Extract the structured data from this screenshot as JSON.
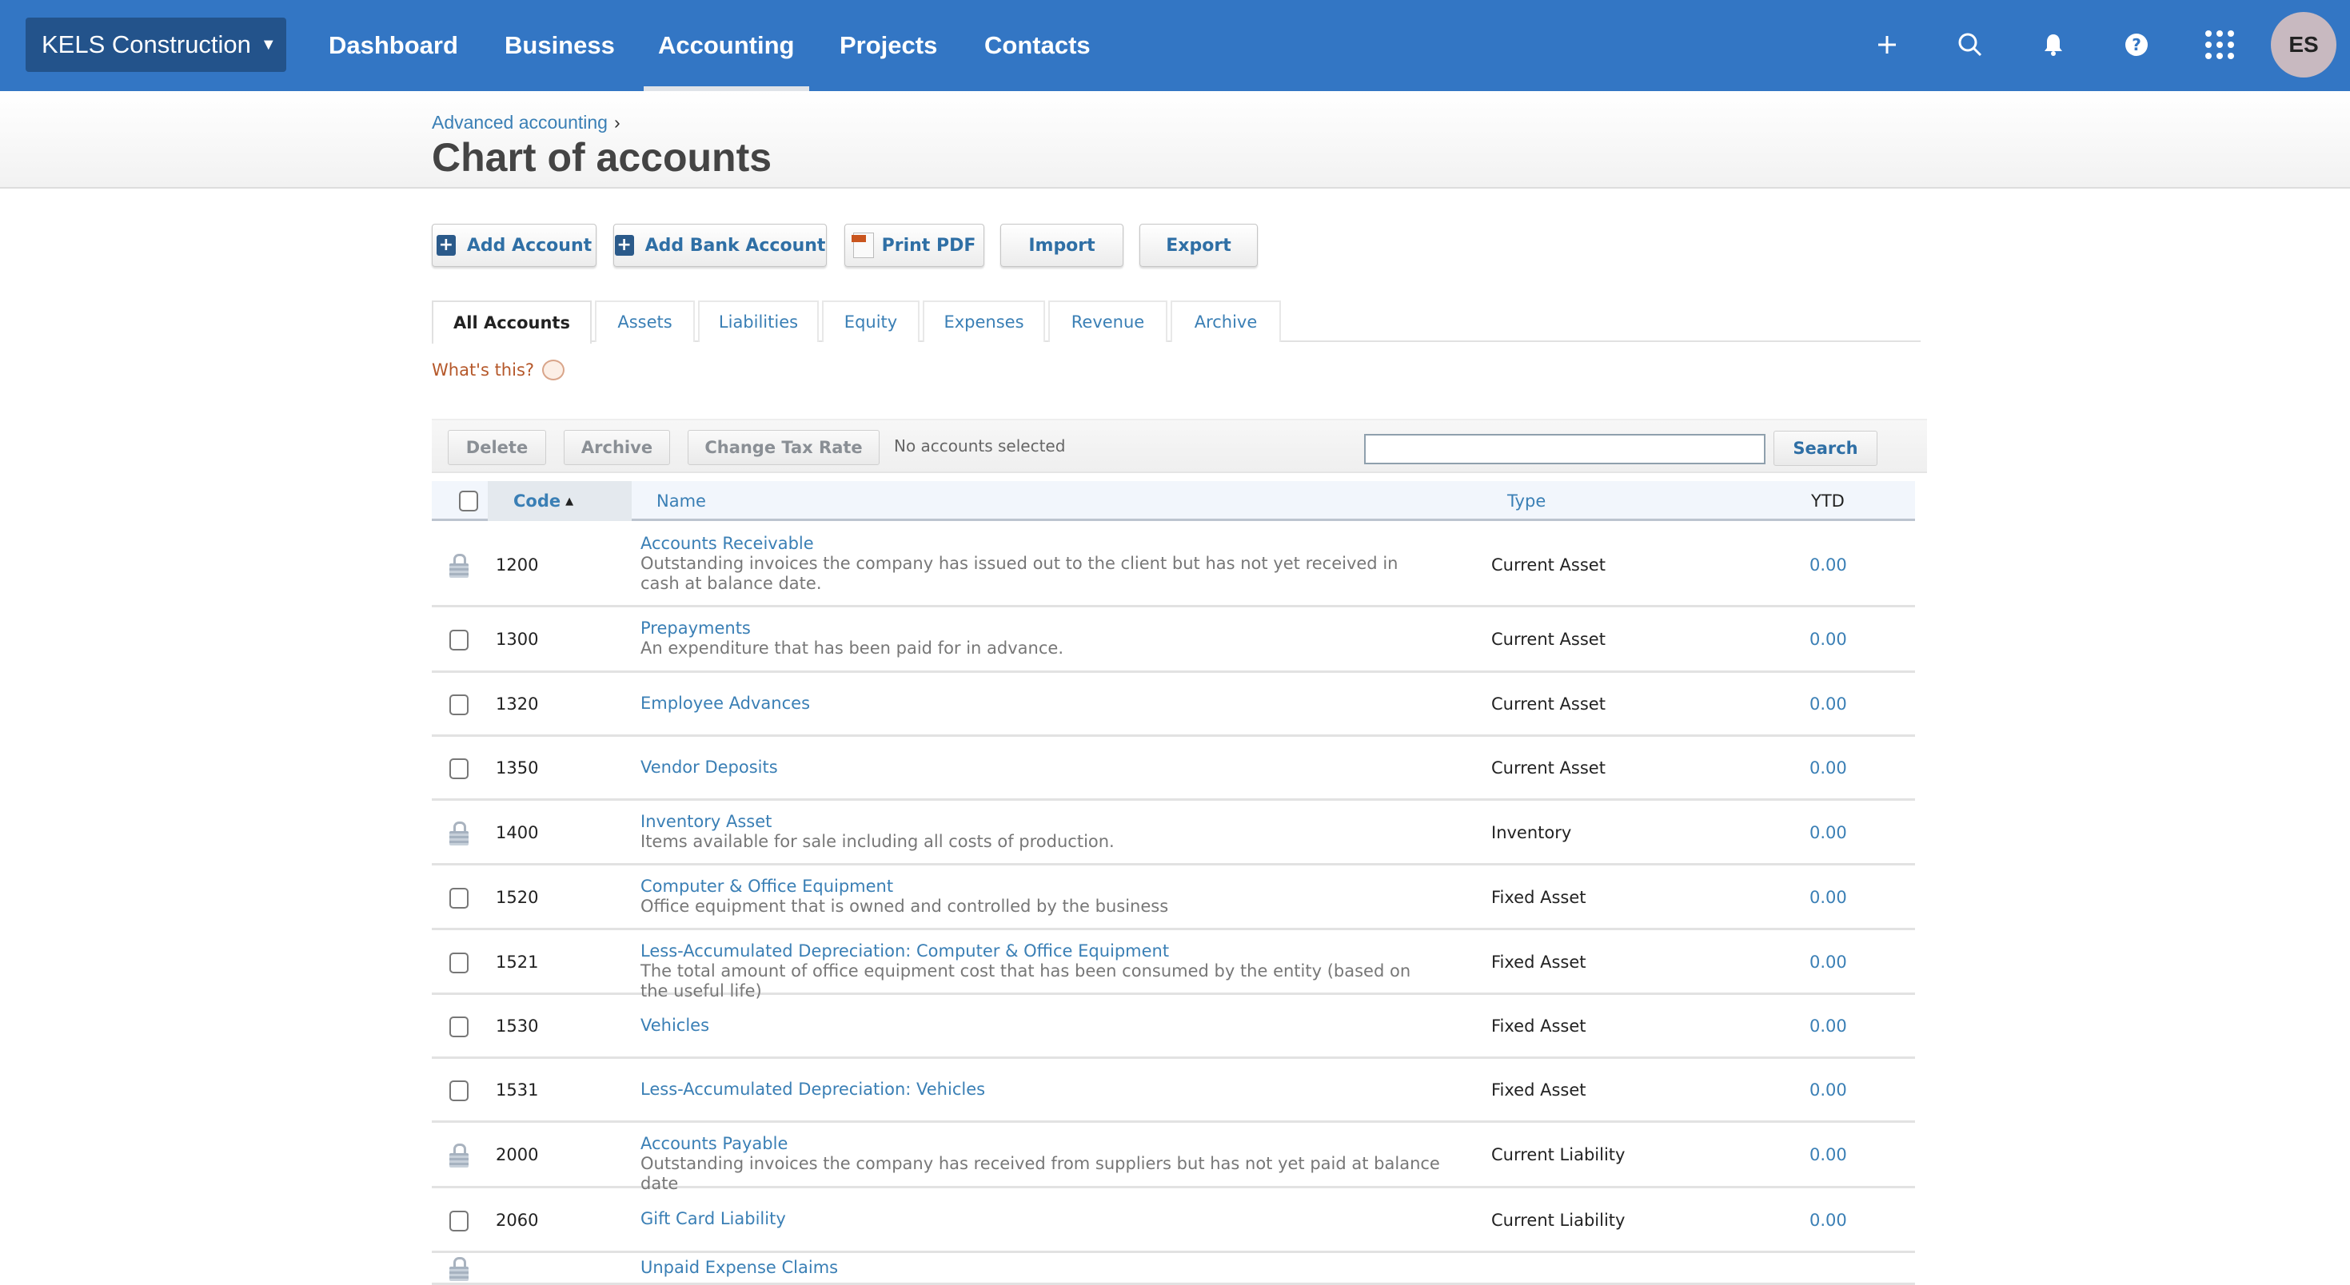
{
  "topnav": {
    "org_name": "KELS Construction",
    "items": [
      "Dashboard",
      "Business",
      "Accounting",
      "Projects",
      "Contacts"
    ],
    "active_item": "Accounting",
    "avatar_initials": "ES",
    "icons": [
      "plus-icon",
      "search-icon",
      "bell-icon",
      "help-icon",
      "apps-grid-icon"
    ]
  },
  "header": {
    "breadcrumb": "Advanced accounting",
    "breadcrumb_sep": "›",
    "title": "Chart of accounts"
  },
  "toolbar": {
    "add_account": "Add Account",
    "add_bank_account": "Add Bank Account",
    "print_pdf": "Print PDF",
    "import": "Import",
    "export": "Export"
  },
  "tabs": [
    "All Accounts",
    "Assets",
    "Liabilities",
    "Equity",
    "Expenses",
    "Revenue",
    "Archive"
  ],
  "active_tab": "All Accounts",
  "whats_this": "What's this?",
  "actions": {
    "delete": "Delete",
    "archive": "Archive",
    "change_tax_rate": "Change Tax Rate",
    "status": "No accounts selected",
    "search_value": "",
    "search_button": "Search"
  },
  "table": {
    "columns": {
      "code": "Code",
      "sort_indicator": "▲",
      "name": "Name",
      "type": "Type",
      "ytd": "YTD"
    },
    "rows": [
      {
        "locked": true,
        "code": "1200",
        "name": "Accounts Receivable",
        "desc": "Outstanding invoices the company has issued out to the client but has not yet received in cash at balance date.",
        "type": "Current Asset",
        "ytd": "0.00"
      },
      {
        "locked": false,
        "code": "1300",
        "name": "Prepayments",
        "desc": "An expenditure that has been paid for in advance.",
        "type": "Current Asset",
        "ytd": "0.00"
      },
      {
        "locked": false,
        "code": "1320",
        "name": "Employee Advances",
        "desc": "",
        "type": "Current Asset",
        "ytd": "0.00"
      },
      {
        "locked": false,
        "code": "1350",
        "name": "Vendor Deposits",
        "desc": "",
        "type": "Current Asset",
        "ytd": "0.00"
      },
      {
        "locked": true,
        "code": "1400",
        "name": "Inventory Asset",
        "desc": "Items available for sale including all costs of production.",
        "type": "Inventory",
        "ytd": "0.00"
      },
      {
        "locked": false,
        "code": "1520",
        "name": "Computer & Office Equipment",
        "desc": "Office equipment that is owned and controlled by the business",
        "type": "Fixed Asset",
        "ytd": "0.00"
      },
      {
        "locked": false,
        "code": "1521",
        "name": "Less-Accumulated Depreciation: Computer & Office Equipment",
        "desc": "The total amount of office equipment cost that has been consumed by the entity (based on the useful life)",
        "type": "Fixed Asset",
        "ytd": "0.00"
      },
      {
        "locked": false,
        "code": "1530",
        "name": "Vehicles",
        "desc": "",
        "type": "Fixed Asset",
        "ytd": "0.00"
      },
      {
        "locked": false,
        "code": "1531",
        "name": "Less-Accumulated Depreciation: Vehicles",
        "desc": "",
        "type": "Fixed Asset",
        "ytd": "0.00"
      },
      {
        "locked": true,
        "code": "2000",
        "name": "Accounts Payable",
        "desc": "Outstanding invoices the company has received from suppliers but has not yet paid at balance date",
        "type": "Current Liability",
        "ytd": "0.00"
      },
      {
        "locked": false,
        "code": "2060",
        "name": "Gift Card Liability",
        "desc": "",
        "type": "Current Liability",
        "ytd": "0.00"
      },
      {
        "locked": true,
        "code": "",
        "name": "Unpaid Expense Claims",
        "desc": "",
        "type": "",
        "ytd": ""
      }
    ]
  }
}
